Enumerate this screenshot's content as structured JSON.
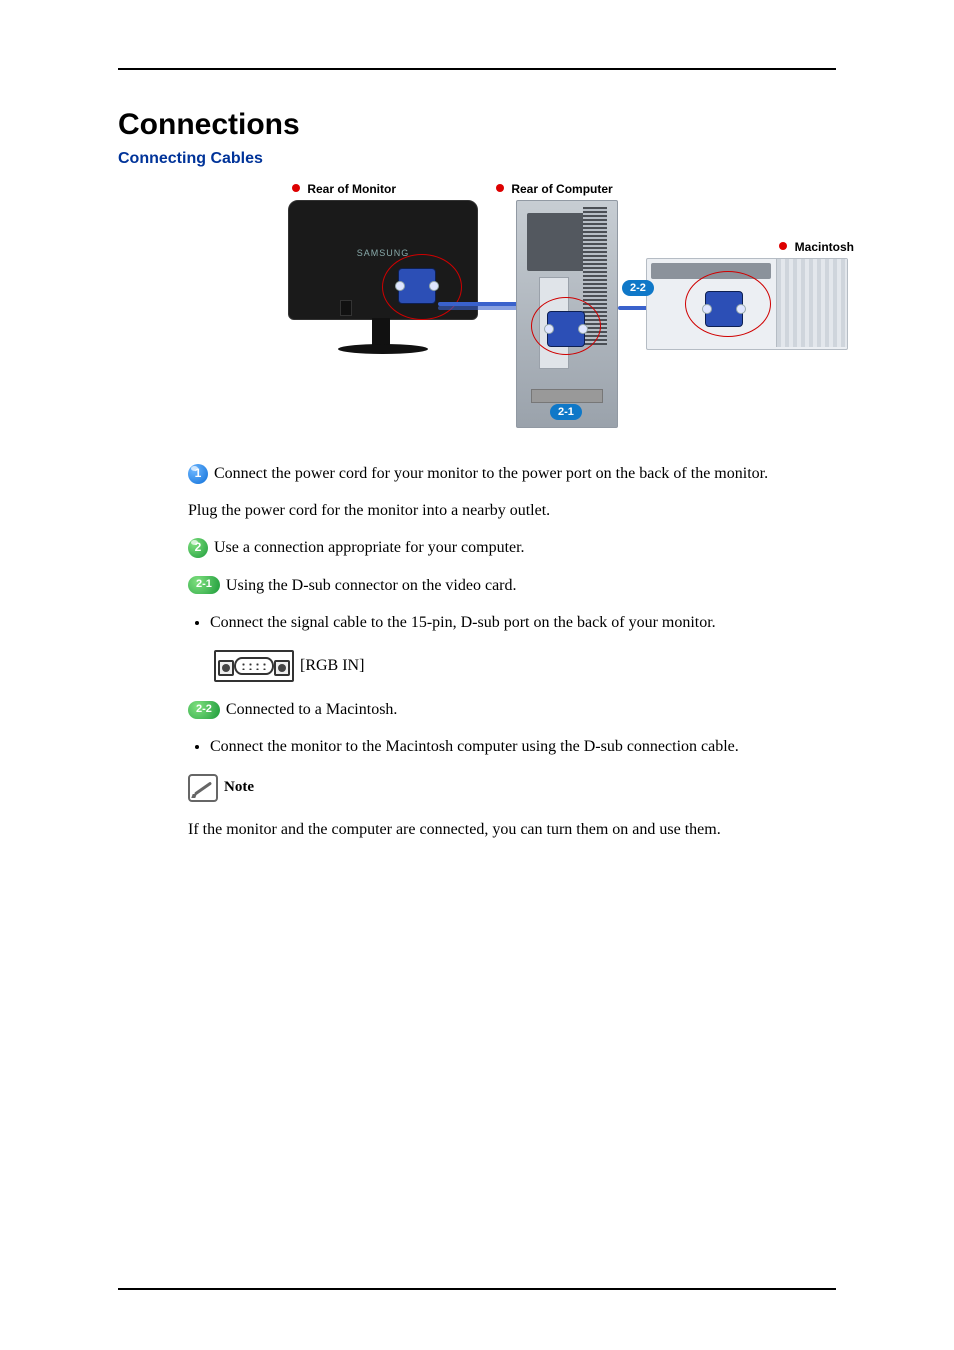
{
  "title": "Connections",
  "subtitle": "Connecting Cables",
  "diagram": {
    "rear_monitor": "Rear of Monitor",
    "rear_computer": "Rear of Computer",
    "macintosh": "Macintosh",
    "monitor_brand": "SAMSUNG",
    "tag_21": "2-1",
    "tag_22": "2-2"
  },
  "badges": {
    "n1": "1",
    "n2": "2",
    "p21": "2-1",
    "p22": "2-2"
  },
  "body": {
    "step1": "Connect the power cord for your monitor to the power port on the back of the monitor.",
    "step1b": "Plug the power cord for the monitor into a nearby outlet.",
    "step2": "Use a connection appropriate for your computer.",
    "step21": "Using the D-sub connector on the video card.",
    "step21_bullet": "Connect the signal cable to the 15-pin, D-sub port on the back of your monitor.",
    "rgb_label": "[RGB IN]",
    "step22": "Connected to a Macintosh.",
    "step22_bullet": "Connect the monitor to the Macintosh computer using the D-sub connection cable.",
    "note_label": "Note",
    "note_text": "If the monitor and the computer are connected, you can turn them on and use them."
  }
}
